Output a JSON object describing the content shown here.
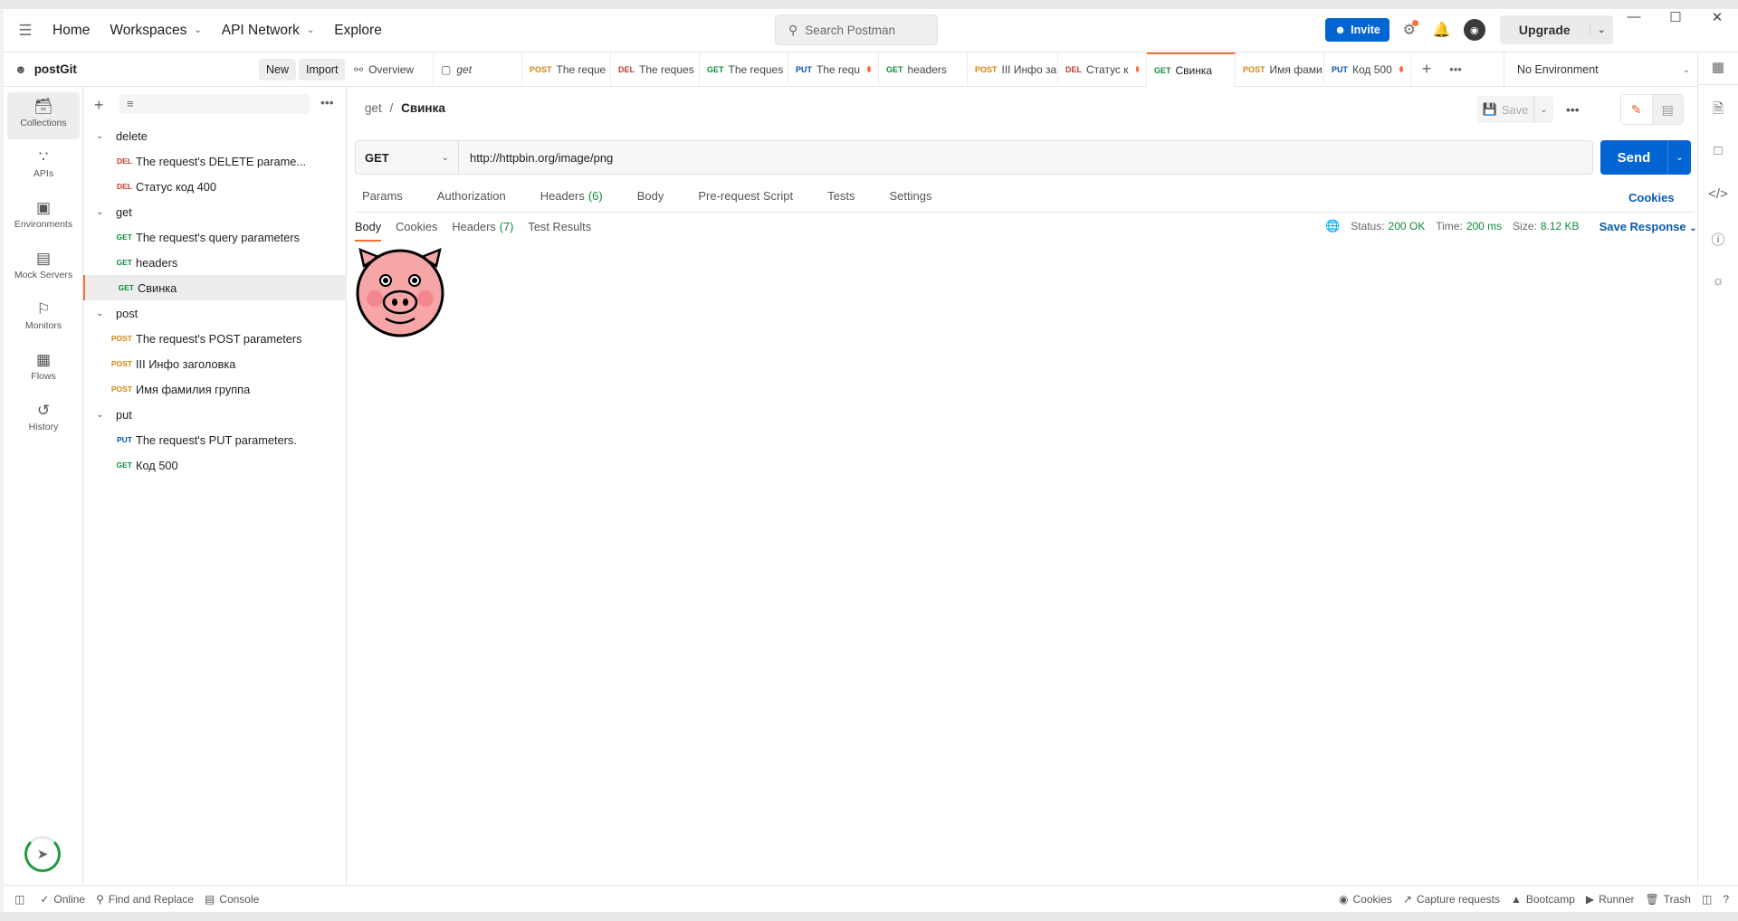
{
  "topbar": {
    "menu_icon": "hamburger-icon",
    "nav": [
      "Home",
      "Workspaces",
      "API Network",
      "Explore"
    ],
    "search_placeholder": "Search Postman",
    "invite": "Invite",
    "upgrade": "Upgrade"
  },
  "workspace": {
    "name": "postGit",
    "new_label": "New",
    "import_label": "Import"
  },
  "rail": [
    {
      "label": "Collections",
      "icon": "collections-icon"
    },
    {
      "label": "APIs",
      "icon": "apis-icon"
    },
    {
      "label": "Environments",
      "icon": "environments-icon"
    },
    {
      "label": "Mock Servers",
      "icon": "mock-servers-icon"
    },
    {
      "label": "Monitors",
      "icon": "monitors-icon"
    },
    {
      "label": "Flows",
      "icon": "flows-icon"
    },
    {
      "label": "History",
      "icon": "history-icon"
    }
  ],
  "tree": [
    {
      "type": "folder",
      "name": "delete"
    },
    {
      "type": "req",
      "method": "DEL",
      "name": "The request's DELETE parame..."
    },
    {
      "type": "req",
      "method": "DEL",
      "name": "Статус код 400"
    },
    {
      "type": "folder",
      "name": "get"
    },
    {
      "type": "req",
      "method": "GET",
      "name": "The request's query parameters"
    },
    {
      "type": "req",
      "method": "GET",
      "name": "headers"
    },
    {
      "type": "req",
      "method": "GET",
      "name": "Свинка",
      "selected": true
    },
    {
      "type": "folder",
      "name": "post"
    },
    {
      "type": "req",
      "method": "POST",
      "name": "The request's POST parameters"
    },
    {
      "type": "req",
      "method": "POST",
      "name": "III Инфо заголовка"
    },
    {
      "type": "req",
      "method": "POST",
      "name": "Имя фамилия группа"
    },
    {
      "type": "folder",
      "name": "put"
    },
    {
      "type": "req",
      "method": "PUT",
      "name": "The request's PUT parameters."
    },
    {
      "type": "req",
      "method": "GET",
      "name": "Код 500"
    }
  ],
  "tabs": [
    {
      "method": "",
      "name": "Overview",
      "icon": "overview-icon"
    },
    {
      "method": "",
      "name": "get",
      "icon": "folder-icon"
    },
    {
      "method": "POST",
      "name": "The reque"
    },
    {
      "method": "DEL",
      "name": "The reques"
    },
    {
      "method": "GET",
      "name": "The reques"
    },
    {
      "method": "PUT",
      "name": "The requ",
      "dot": true
    },
    {
      "method": "GET",
      "name": "headers"
    },
    {
      "method": "POST",
      "name": "III Инфо за"
    },
    {
      "method": "DEL",
      "name": "Статус к",
      "dot": true
    },
    {
      "method": "GET",
      "name": "Свинка",
      "active": true
    },
    {
      "method": "POST",
      "name": "Имя фами"
    },
    {
      "method": "PUT",
      "name": "Код 500",
      "dot": true
    }
  ],
  "environment": "No Environment",
  "request": {
    "breadcrumb_parent": "get",
    "breadcrumb_sep": "/",
    "breadcrumb_name": "Свинка",
    "save": "Save",
    "method": "GET",
    "url": "http://httpbin.org/image/png",
    "send": "Send",
    "tabs": [
      {
        "label": "Params"
      },
      {
        "label": "Authorization"
      },
      {
        "label": "Headers",
        "count": "(6)"
      },
      {
        "label": "Body"
      },
      {
        "label": "Pre-request Script"
      },
      {
        "label": "Tests"
      },
      {
        "label": "Settings"
      }
    ],
    "cookies": "Cookies"
  },
  "response": {
    "tabs": [
      {
        "label": "Body",
        "active": true
      },
      {
        "label": "Cookies"
      },
      {
        "label": "Headers",
        "count": "(7)"
      },
      {
        "label": "Test Results"
      }
    ],
    "status_label": "Status:",
    "status": "200 OK",
    "time_label": "Time:",
    "time": "200 ms",
    "size_label": "Size:",
    "size": "8.12 KB",
    "save_response": "Save Response"
  },
  "statusbar": {
    "online": "Online",
    "find_replace": "Find and Replace",
    "console": "Console",
    "cookies": "Cookies",
    "capture": "Capture requests",
    "bootcamp": "Bootcamp",
    "runner": "Runner",
    "trash": "Trash"
  },
  "colors": {
    "accent": "#ff6c37",
    "primary": "#0265d2",
    "get": "#0f8c3b",
    "post": "#ad7a03",
    "del": "#8e1a10",
    "put": "#0053b8"
  }
}
